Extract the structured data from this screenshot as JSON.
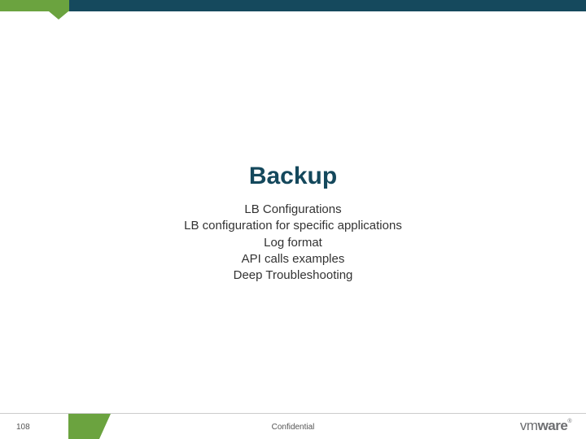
{
  "slide": {
    "title": "Backup",
    "items": [
      "LB Configurations",
      "LB configuration for specific applications",
      "Log format",
      "API calls examples",
      "Deep Troubleshooting"
    ]
  },
  "footer": {
    "page_number": "108",
    "confidential": "Confidential",
    "logo_vm": "vm",
    "logo_ware": "ware",
    "logo_reg": "®"
  }
}
